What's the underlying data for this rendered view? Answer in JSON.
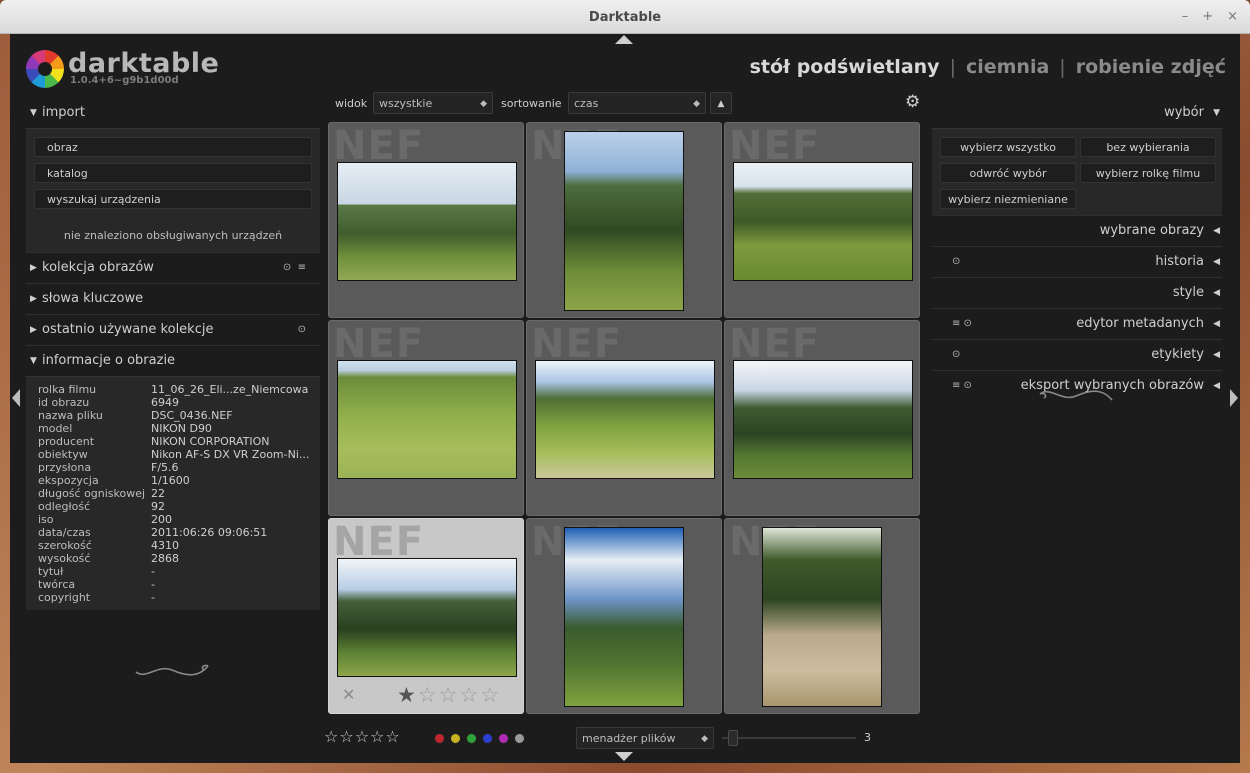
{
  "window": {
    "title": "Darktable"
  },
  "brand": {
    "name": "darktable",
    "version": "1.0.4+6~g9b1d00d"
  },
  "views": {
    "lighttable": "stół podświetlany",
    "darkroom": "ciemnia",
    "tethering": "robienie zdjęć",
    "sep": "|"
  },
  "left_panel": {
    "import": {
      "title": "import",
      "buttons": [
        "obraz",
        "katalog",
        "wyszukaj urządzenia"
      ],
      "note": "nie znaleziono obsługiwanych urządzeń"
    },
    "sections": [
      {
        "title": "kolekcja obrazów"
      },
      {
        "title": "słowa kluczowe"
      },
      {
        "title": "ostatnio używane kolekcje"
      }
    ],
    "image_info": {
      "title": "informacje o obrazie",
      "rows": [
        {
          "k": "rolka filmu",
          "v": "11_06_26_Eli...ze_Niemcowa"
        },
        {
          "k": "id obrazu",
          "v": "6949"
        },
        {
          "k": "nazwa pliku",
          "v": "DSC_0436.NEF"
        },
        {
          "k": "model",
          "v": "NIKON D90"
        },
        {
          "k": "producent",
          "v": "NIKON CORPORATION"
        },
        {
          "k": "obiektyw",
          "v": "Nikon AF-S DX VR Zoom-Ni..."
        },
        {
          "k": "przysłona",
          "v": "F/5.6"
        },
        {
          "k": "ekspozycja",
          "v": "1/1600"
        },
        {
          "k": "długość ogniskowej",
          "v": "22"
        },
        {
          "k": "odległość",
          "v": "92"
        },
        {
          "k": "iso",
          "v": "200"
        },
        {
          "k": "data/czas",
          "v": "2011:06:26 09:06:51"
        },
        {
          "k": "szerokość",
          "v": "4310"
        },
        {
          "k": "wysokość",
          "v": "2868"
        },
        {
          "k": "tytuł",
          "v": "-"
        },
        {
          "k": "twórca",
          "v": "-"
        },
        {
          "k": "copyright",
          "v": "-"
        }
      ]
    }
  },
  "toolbar": {
    "view_label": "widok",
    "view_value": "wszystkie",
    "sort_label": "sortowanie",
    "sort_value": "czas"
  },
  "grid": {
    "badge": "NEF",
    "hover_rating": 1,
    "thumbs": [
      {
        "orient": "land",
        "tone": "sky1"
      },
      {
        "orient": "port",
        "tone": "sky2"
      },
      {
        "orient": "land",
        "tone": "sky3"
      },
      {
        "orient": "land",
        "tone": "sky4"
      },
      {
        "orient": "land",
        "tone": "sky5"
      },
      {
        "orient": "land",
        "tone": "sky6"
      },
      {
        "orient": "land",
        "tone": "sky7",
        "hover": true
      },
      {
        "orient": "port",
        "tone": "sky8"
      },
      {
        "orient": "port",
        "tone": "sky9"
      }
    ]
  },
  "bottom": {
    "stars": "☆☆☆☆☆",
    "color_labels": [
      "#c0262e",
      "#c9b21f",
      "#2ea33a",
      "#2a3ed0",
      "#b02ab5",
      "#9a9a9a"
    ],
    "layout_value": "menadżer plików",
    "zoom_value": "3"
  },
  "right_panel": {
    "select": {
      "title": "wybór",
      "buttons": [
        "wybierz wszystko",
        "bez wybierania",
        "odwróć wybór",
        "wybierz rolkę filmu",
        "wybierz niezmieniane"
      ]
    },
    "sections": [
      {
        "title": "wybrane obrazy",
        "icons": ""
      },
      {
        "title": "historia",
        "icons": "⊙"
      },
      {
        "title": "style",
        "icons": ""
      },
      {
        "title": "edytor metadanych",
        "icons": "≡ ⊙"
      },
      {
        "title": "etykiety",
        "icons": "⊙"
      },
      {
        "title": "eksport wybranych obrazów",
        "icons": "≡ ⊙"
      }
    ]
  }
}
